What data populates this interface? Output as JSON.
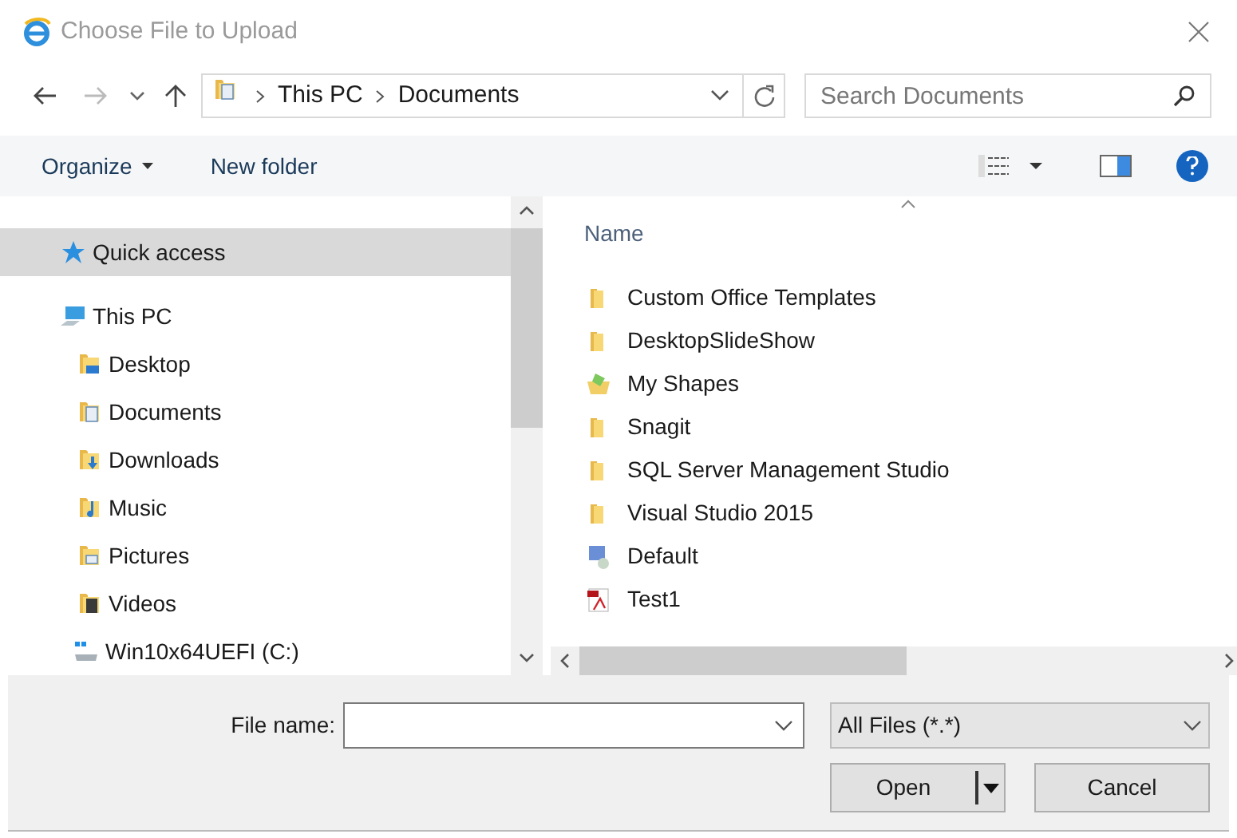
{
  "window": {
    "title": "Choose File to Upload"
  },
  "address_bar": {
    "segments": [
      "This PC",
      "Documents"
    ]
  },
  "search": {
    "placeholder": "Search Documents"
  },
  "toolbar": {
    "organize": "Organize",
    "new_folder": "New folder"
  },
  "navigation": [
    {
      "label": "Quick access",
      "kind": "star",
      "selected": true
    },
    {
      "label": "This PC",
      "kind": "computer",
      "selected": false,
      "children": [
        {
          "label": "Desktop",
          "kind": "desktop",
          "selected": false
        },
        {
          "label": "Documents",
          "kind": "documents",
          "selected": false
        },
        {
          "label": "Downloads",
          "kind": "downloads",
          "selected": false
        },
        {
          "label": "Music",
          "kind": "music",
          "selected": false
        },
        {
          "label": "Pictures",
          "kind": "pictures",
          "selected": false
        },
        {
          "label": "Videos",
          "kind": "videos",
          "selected": false
        },
        {
          "label": "Win10x64UEFI (C:)",
          "kind": "drive",
          "selected": false
        }
      ]
    }
  ],
  "file_list": {
    "column": "Name",
    "items": [
      {
        "name": "Custom Office Templates",
        "kind": "folder"
      },
      {
        "name": "DesktopSlideShow",
        "kind": "folder"
      },
      {
        "name": "My Shapes",
        "kind": "shapes"
      },
      {
        "name": "Snagit",
        "kind": "folder"
      },
      {
        "name": "SQL Server Management Studio",
        "kind": "folder"
      },
      {
        "name": "Visual Studio 2015",
        "kind": "folder"
      },
      {
        "name": "Default",
        "kind": "shortcut"
      },
      {
        "name": "Test1",
        "kind": "pdf"
      }
    ]
  },
  "file_name": {
    "label": "File name:"
  },
  "file_type": {
    "value": "All Files (*.*)"
  },
  "buttons": [
    {
      "label": "Open",
      "kind": "split"
    },
    {
      "label": "Cancel",
      "kind": "plain"
    }
  ]
}
